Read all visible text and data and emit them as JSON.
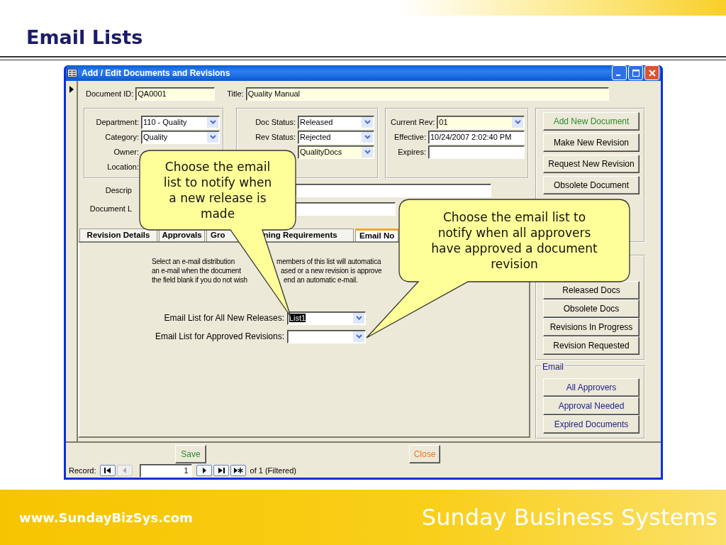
{
  "slide": {
    "title": "Email Lists",
    "website": "www.SundayBizSys.com",
    "company": "Sunday Business Systems"
  },
  "window": {
    "title": "Add / Edit Documents and Revisions",
    "document_id": {
      "label": "Document ID:",
      "value": "QA0001",
      "highlighted": true
    },
    "title_field": {
      "label": "Title:",
      "value": "Quality Manual",
      "highlighted": true
    },
    "groups": [
      {
        "fields": [
          {
            "label": "Department:",
            "value": "110 - Quality",
            "kind": "combo",
            "highlighted": false
          },
          {
            "label": "Category:",
            "value": "Quality",
            "kind": "combo",
            "highlighted": false
          },
          {
            "label": "Owner:"
          },
          {
            "label": "Location:"
          }
        ]
      },
      {
        "fields": [
          {
            "label": "Doc Status:",
            "value": "Released",
            "kind": "combo",
            "highlighted": false
          },
          {
            "label": "Rev Status:",
            "value": "Rejected",
            "kind": "combo",
            "highlighted": false
          },
          {
            "value": "QualityDocs",
            "kind": "combo",
            "highlighted": true
          }
        ]
      },
      {
        "fields": [
          {
            "label": "Current Rev:",
            "value": "01",
            "kind": "combo",
            "highlighted": true
          },
          {
            "label": "Effective:",
            "value": "10/24/2007 2:02:40 PM",
            "kind": "text",
            "highlighted": false
          },
          {
            "label": "Expires:",
            "kind": "text",
            "highlighted": false
          }
        ]
      }
    ],
    "description": {
      "label": "Descrip"
    },
    "document_link": {
      "label": "Document L"
    },
    "tabs": [
      {
        "parts": [
          "Revision Details"
        ],
        "selected": false
      },
      {
        "parts": [
          "Approvals"
        ],
        "selected": false
      },
      {
        "parts": [
          "Gro",
          "ning Requirements"
        ],
        "selected": false
      },
      {
        "parts": [
          "Email No"
        ],
        "selected": true
      }
    ],
    "tab_page": {
      "intro_lines": [
        [
          "Select an e-mail distribution",
          "members of this list will automatica"
        ],
        [
          "an e-mail when the document",
          "ased or a new revision is approve"
        ],
        [
          "the field blank if you do not wish",
          "end an automatic e-mail."
        ]
      ],
      "fields": [
        {
          "label": "Email List for All New Releases:",
          "value": "List1",
          "text_selected": true
        },
        {
          "label": "Email List for Approved Revisions:"
        }
      ]
    },
    "action_buttons": [
      {
        "label": "Add New Document",
        "color": "#2e8b2e"
      },
      {
        "label": "Make New Revision",
        "color": "#000000"
      },
      {
        "label": "Request New Revision",
        "color": "#000000"
      },
      {
        "label": "Obsolete Document",
        "color": "#000000"
      }
    ],
    "filter_buttons": [
      {
        "label": "Released Docs"
      },
      {
        "label": "Obsolete Docs"
      },
      {
        "label": "Revisions In Progress"
      },
      {
        "label": "Revision Requested"
      }
    ],
    "email_group": {
      "legend": "Email",
      "buttons": [
        {
          "label": "All Approvers"
        },
        {
          "label": "Approval Needed"
        },
        {
          "label": "Expired Documents"
        }
      ]
    },
    "footer_buttons": [
      {
        "label": "Save",
        "color": "#2e8b2e"
      },
      {
        "label": "Close",
        "color": "#e8782a"
      }
    ],
    "navigator": {
      "label": "Record:",
      "items": [
        {
          "kind": "first",
          "disabled": false
        },
        {
          "kind": "prev",
          "disabled": true
        },
        {
          "kind": "position",
          "value": "1"
        },
        {
          "kind": "next",
          "disabled": false
        },
        {
          "kind": "last",
          "disabled": false
        },
        {
          "kind": "new",
          "disabled": false
        }
      ],
      "count": "of  1 (Filtered)"
    }
  },
  "callouts": [
    {
      "lines": [
        "Choose the email",
        "list to notify when",
        "a new release is",
        "made"
      ]
    },
    {
      "lines": [
        "Choose the email list to",
        "notify when all approvers",
        "have approved a document",
        "revision"
      ]
    }
  ]
}
